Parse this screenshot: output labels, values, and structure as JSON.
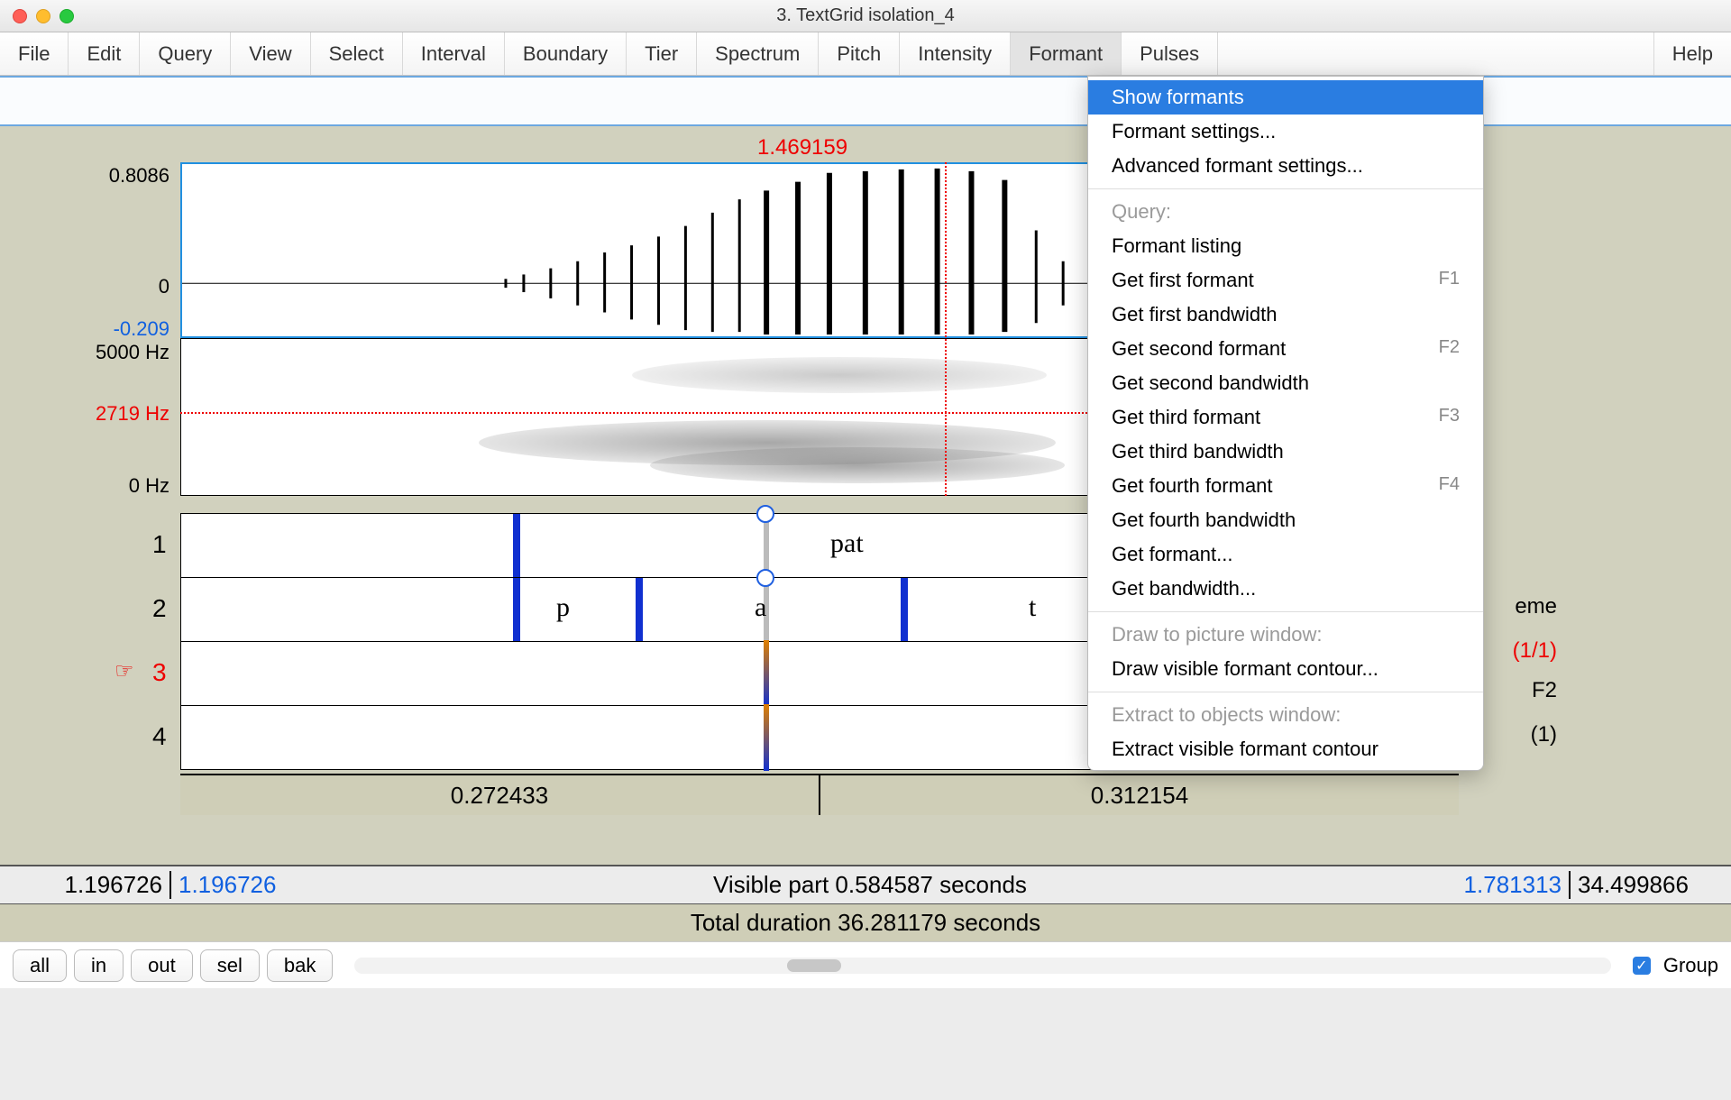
{
  "window": {
    "title": "3. TextGrid isolation_4"
  },
  "menu": {
    "items": [
      "File",
      "Edit",
      "Query",
      "View",
      "Select",
      "Interval",
      "Boundary",
      "Tier",
      "Spectrum",
      "Pitch",
      "Intensity",
      "Formant",
      "Pulses"
    ],
    "help": "Help",
    "open_index": 11
  },
  "formant_menu": {
    "show": "Show formants",
    "settings": "Formant settings...",
    "advanced": "Advanced formant settings...",
    "query_hdr": "Query:",
    "items": [
      {
        "label": "Formant listing",
        "sc": ""
      },
      {
        "label": "Get first formant",
        "sc": "F1"
      },
      {
        "label": "Get first bandwidth",
        "sc": ""
      },
      {
        "label": "Get second formant",
        "sc": "F2"
      },
      {
        "label": "Get second bandwidth",
        "sc": ""
      },
      {
        "label": "Get third formant",
        "sc": "F3"
      },
      {
        "label": "Get third bandwidth",
        "sc": ""
      },
      {
        "label": "Get fourth formant",
        "sc": "F4"
      },
      {
        "label": "Get fourth bandwidth",
        "sc": ""
      },
      {
        "label": "Get formant...",
        "sc": ""
      },
      {
        "label": "Get bandwidth...",
        "sc": ""
      }
    ],
    "draw_hdr": "Draw to picture window:",
    "draw": "Draw visible formant contour...",
    "extract_hdr": "Extract to objects window:",
    "extract": "Extract visible formant contour"
  },
  "readouts": {
    "cursor_time": "1.469159",
    "wave_max": "0.8086",
    "wave_zero": "0",
    "wave_min": "-0.209",
    "spec_max": "5000 Hz",
    "spec_cursor": "2719 Hz",
    "spec_min": "0 Hz"
  },
  "tiers": {
    "labels": [
      "1",
      "2",
      "3",
      "4"
    ],
    "t1_text": "pat",
    "t2_segs": [
      "p",
      "a",
      "t"
    ],
    "right_fraction": "(1/1)",
    "right_r2": "F2",
    "right_r3": "(1)",
    "right_hidden": "eme"
  },
  "selection": {
    "left": "0.272433",
    "right": "0.312154"
  },
  "timebar": {
    "left_out": "1.196726",
    "left_in": "1.196726",
    "visible": "Visible part 0.584587 seconds",
    "right_in": "1.781313",
    "right_out": "34.499866",
    "total": "Total duration 36.281179 seconds"
  },
  "footer": {
    "buttons": [
      "all",
      "in",
      "out",
      "sel",
      "bak"
    ],
    "group": "Group"
  }
}
